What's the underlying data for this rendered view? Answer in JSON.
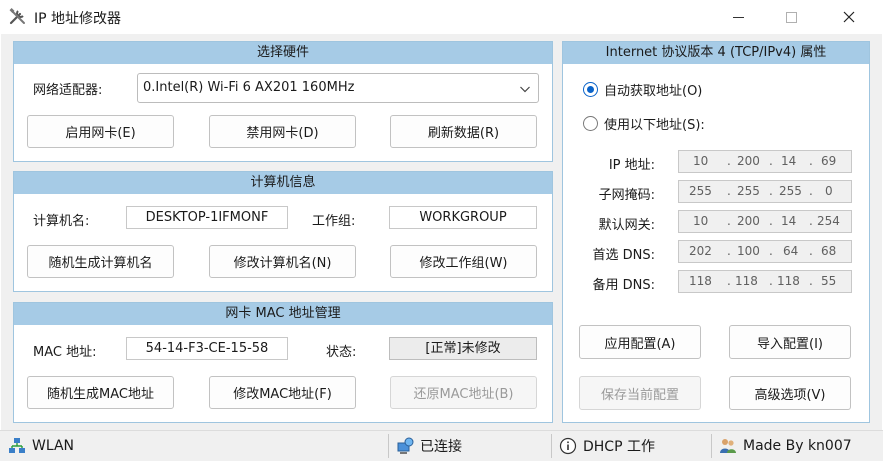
{
  "window": {
    "title": "IP 地址修改器",
    "icon": "tools-icon"
  },
  "hardware": {
    "header": "选择硬件",
    "adapter_label": "网络适配器:",
    "adapter_value": "0.Intel(R) Wi-Fi 6 AX201 160MHz",
    "enable_button": "启用网卡(E)",
    "disable_button": "禁用网卡(D)",
    "refresh_button": "刷新数据(R)"
  },
  "computer": {
    "header": "计算机信息",
    "name_label": "计算机名:",
    "name_value": "DESKTOP-1IFMONF",
    "workgroup_label": "工作组:",
    "workgroup_value": "WORKGROUP",
    "random_name_button": "随机生成计算机名",
    "modify_name_button": "修改计算机名(N)",
    "modify_workgroup_button": "修改工作组(W)"
  },
  "mac": {
    "header": "网卡 MAC 地址管理",
    "mac_label": "MAC 地址:",
    "mac_value": "54-14-F3-CE-15-58",
    "status_label": "状态:",
    "status_value": "[正常]未修改",
    "random_mac_button": "随机生成MAC地址",
    "modify_mac_button": "修改MAC地址(F)",
    "restore_mac_button": "还原MAC地址(B)"
  },
  "ipv4": {
    "header": "Internet 协议版本 4 (TCP/IPv4) 属性",
    "auto_radio": "自动获取地址(O)",
    "manual_radio": "使用以下地址(S):",
    "selected": "auto",
    "fields": [
      {
        "label": "IP 地址:",
        "octets": [
          "10",
          "200",
          "14",
          "69"
        ]
      },
      {
        "label": "子网掩码:",
        "octets": [
          "255",
          "255",
          "255",
          "0"
        ]
      },
      {
        "label": "默认网关:",
        "octets": [
          "10",
          "200",
          "14",
          "254"
        ]
      },
      {
        "label": "首选 DNS:",
        "octets": [
          "202",
          "100",
          "64",
          "68"
        ]
      },
      {
        "label": "备用 DNS:",
        "octets": [
          "118",
          "118",
          "118",
          "55"
        ]
      }
    ],
    "apply_button": "应用配置(A)",
    "import_button": "导入配置(I)",
    "save_button": "保存当前配置",
    "advanced_button": "高级选项(V)"
  },
  "statusbar": {
    "adapter": "WLAN",
    "connection": "已连接",
    "dhcp": "DHCP 工作",
    "author": "Made By kn007"
  },
  "colors": {
    "header_bg": "#a6cbe6",
    "radio_accent": "#0a63c9"
  }
}
